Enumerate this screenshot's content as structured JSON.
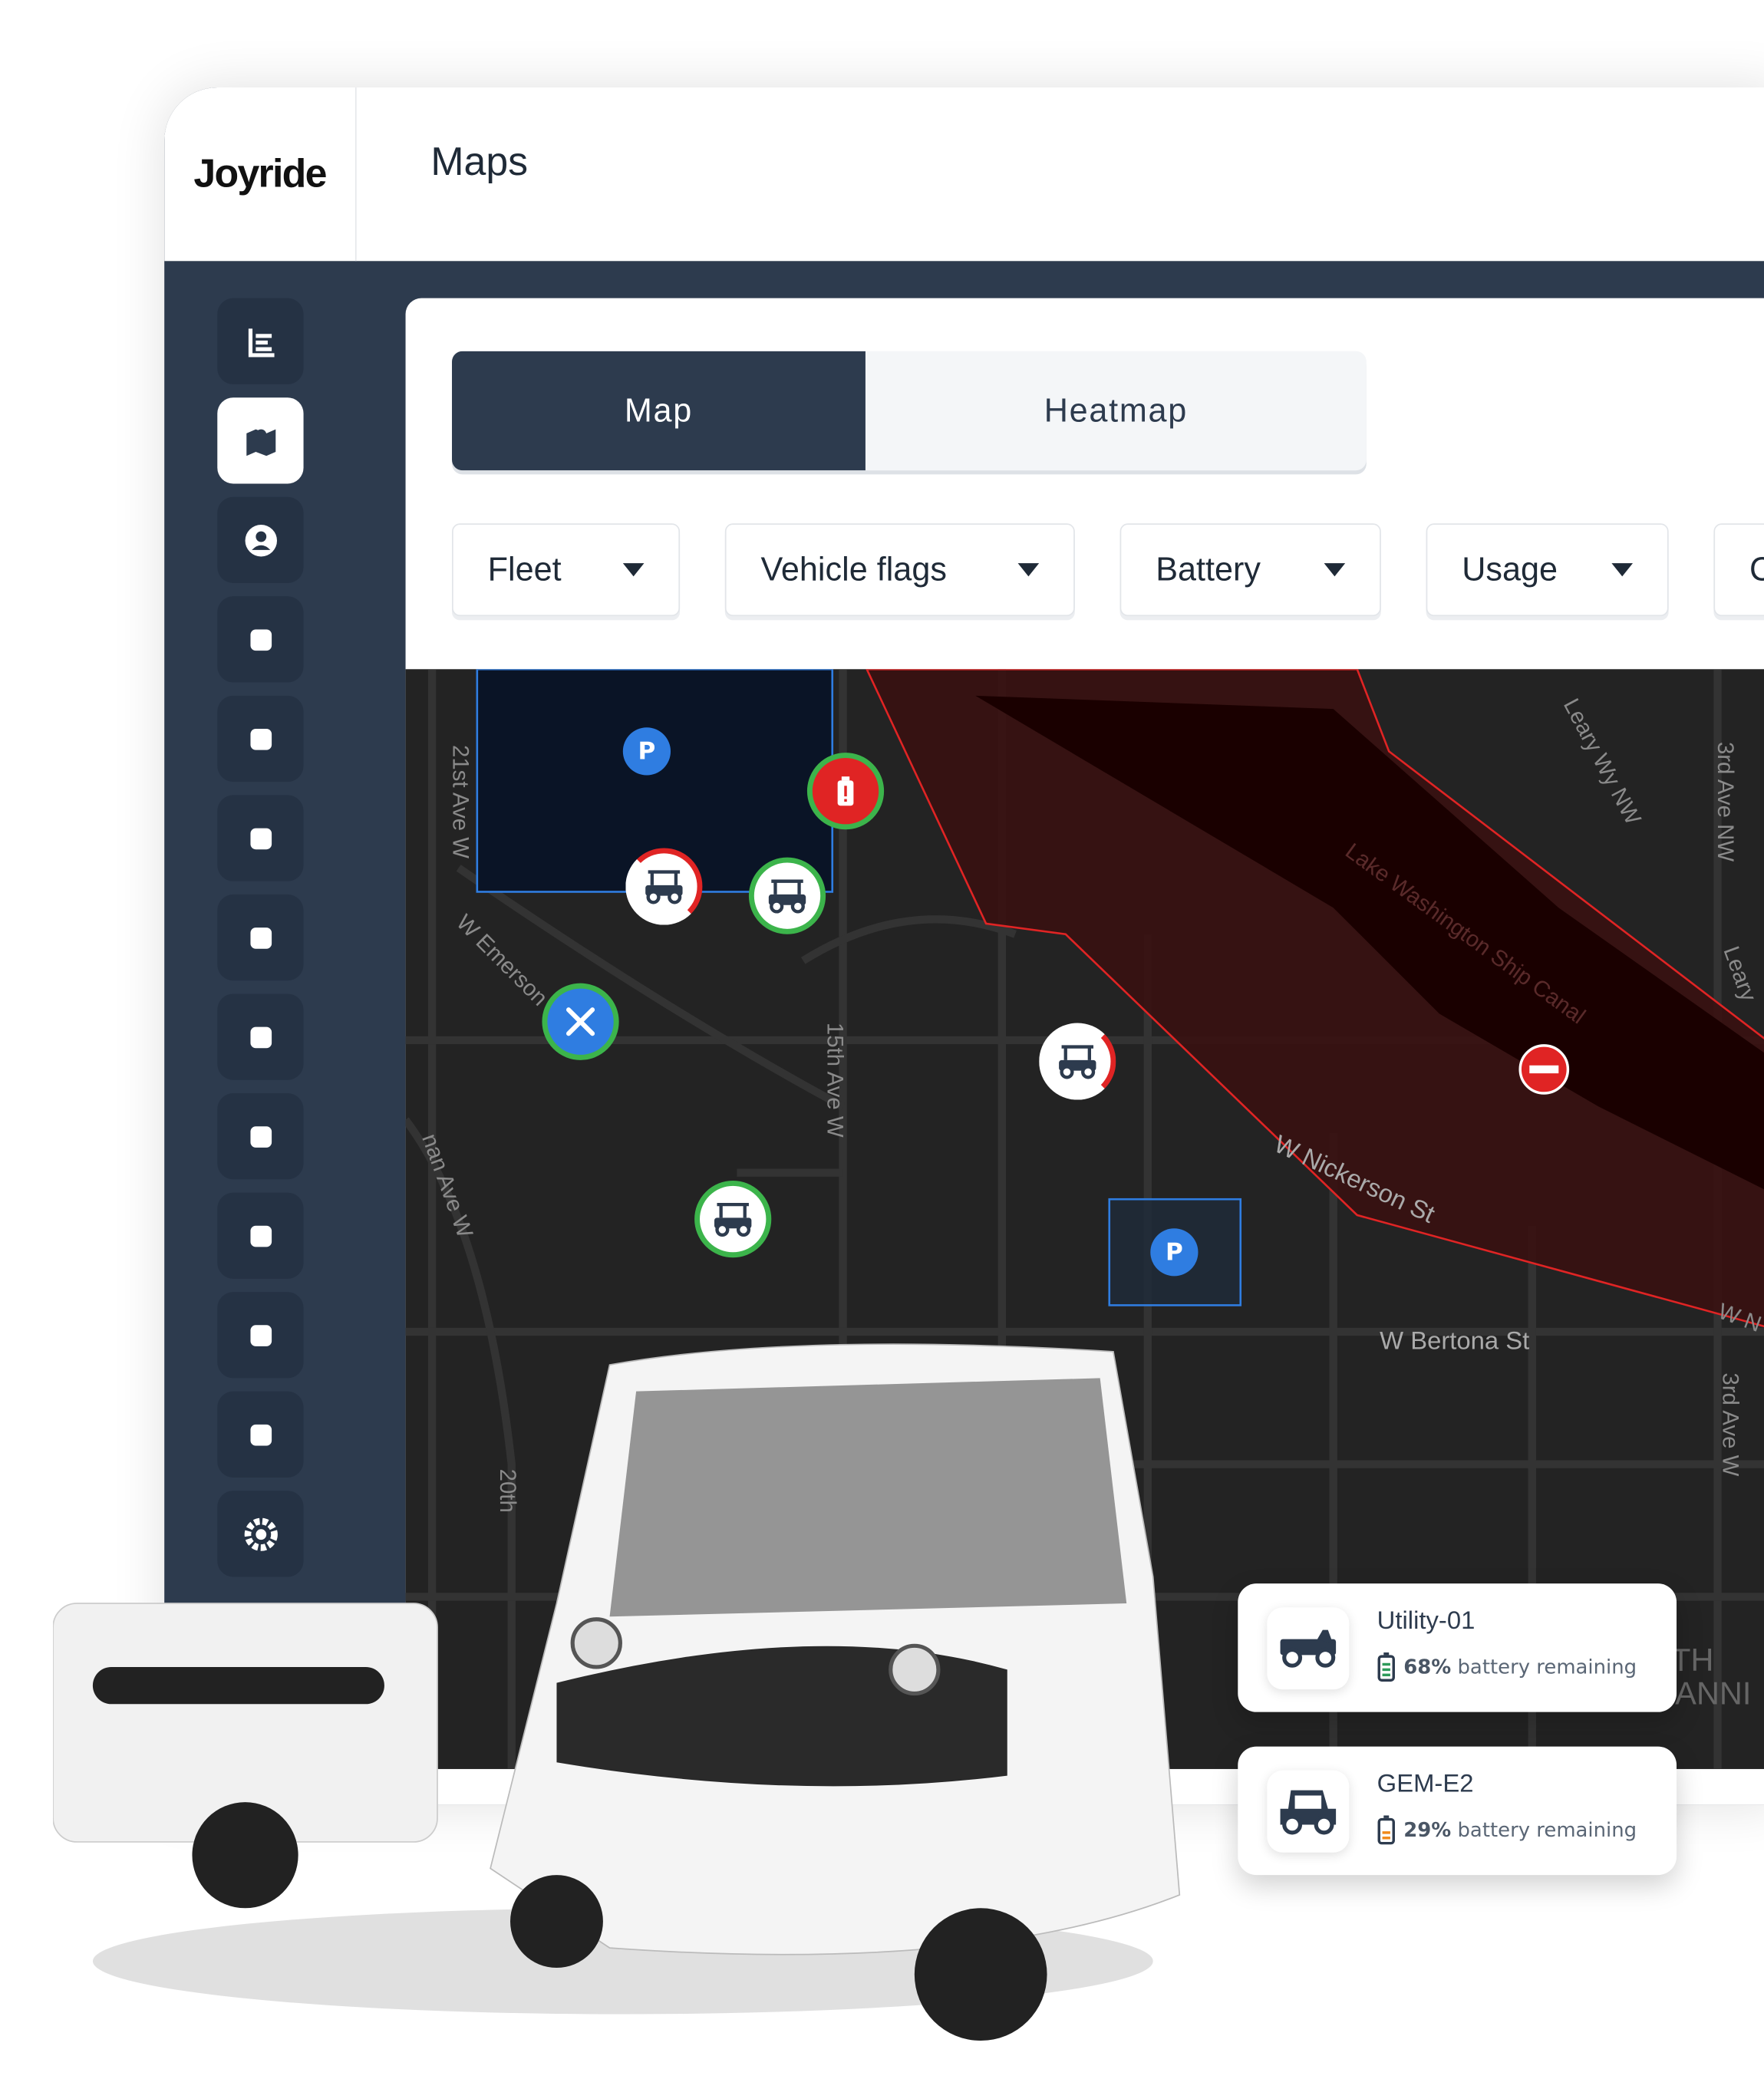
{
  "app": {
    "logo": "Joyride",
    "page_title": "Maps"
  },
  "sidebar": {
    "items": [
      {
        "icon": "reports-icon"
      },
      {
        "icon": "map-icon",
        "active": true
      },
      {
        "icon": "user-icon"
      },
      {
        "icon": "route-icon"
      },
      {
        "icon": "bicycle-icon"
      },
      {
        "icon": "wallet-icon"
      },
      {
        "icon": "support-agent-icon"
      },
      {
        "icon": "layers-icon"
      },
      {
        "icon": "location-pin-icon"
      },
      {
        "icon": "discount-icon"
      },
      {
        "icon": "megaphone-icon"
      },
      {
        "icon": "org-chart-icon"
      },
      {
        "icon": "settings-icon"
      }
    ]
  },
  "tabs": [
    {
      "label": "Map",
      "active": true
    },
    {
      "label": "Heatmap",
      "active": false
    }
  ],
  "filters": [
    {
      "label": "Fleet"
    },
    {
      "label": "Vehicle flags"
    },
    {
      "label": "Battery"
    },
    {
      "label": "Usage"
    },
    {
      "label": "C"
    }
  ],
  "map": {
    "streets": [
      "21st Ave W",
      "W Emerson",
      "15th Ave W",
      "Leary Wy NW",
      "3rd Ave NW",
      "Lake Washington Ship Canal",
      "W Nickerson St",
      "W Bertona St",
      "20th",
      "nan Ave W",
      "Leary",
      "3rd Ave W",
      "W N",
      "TH",
      "ANNI"
    ],
    "parking_label": "P",
    "colors": {
      "zone": "#e02424",
      "parking": "#2f7de1",
      "good": "#3cb44b",
      "map_bg": "#232323"
    }
  },
  "vehicle_cards": [
    {
      "name": "Utility-01",
      "percent": "68%",
      "suffix": "battery remaining",
      "icon": "utility-vehicle-icon",
      "battery_color": "#2e9a5a"
    },
    {
      "name": "GEM-E2",
      "percent": "29%",
      "suffix": "battery remaining",
      "icon": "gem-car-icon",
      "battery_color": "#f08a1c"
    }
  ],
  "colors": {
    "navy": "#2d3b4e",
    "sidebar_button": "#253244"
  }
}
